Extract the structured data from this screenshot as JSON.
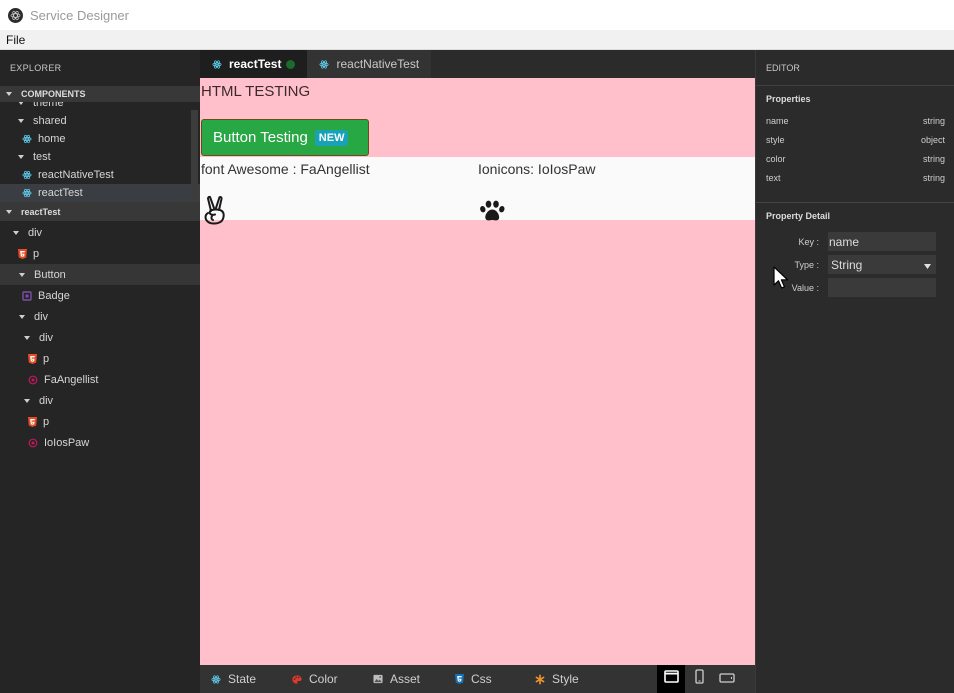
{
  "app": {
    "title": "Service Designer"
  },
  "menu": {
    "file": "File"
  },
  "explorer": {
    "header": "EXPLORER",
    "components_header": "COMPONENTS",
    "component_items": [
      {
        "label": "theme",
        "type": "folder"
      },
      {
        "label": "shared",
        "type": "folder"
      },
      {
        "label": "home",
        "type": "react"
      },
      {
        "label": "test",
        "type": "folder"
      },
      {
        "label": "reactNativeTest",
        "type": "react"
      },
      {
        "label": "reactTest",
        "type": "react"
      }
    ],
    "tree_header": "reactTest",
    "tree_items": [
      {
        "label": "div",
        "type": "folder"
      },
      {
        "label": "p",
        "type": "html5"
      },
      {
        "label": "Button",
        "type": "folder"
      },
      {
        "label": "Badge",
        "type": "component"
      },
      {
        "label": "div",
        "type": "folder"
      },
      {
        "label": "div",
        "type": "folder"
      },
      {
        "label": "p",
        "type": "html5"
      },
      {
        "label": "FaAngellist",
        "type": "icon"
      },
      {
        "label": "div",
        "type": "folder"
      },
      {
        "label": "p",
        "type": "html5"
      },
      {
        "label": "IoIosPaw",
        "type": "icon"
      }
    ]
  },
  "tabs": [
    {
      "label": "reactTest",
      "active": true,
      "modified": true
    },
    {
      "label": "reactNativeTest",
      "active": false,
      "modified": false
    }
  ],
  "canvas": {
    "heading": "HTML TESTING",
    "button_label": "Button Testing",
    "badge_label": "NEW",
    "fa_label": "font Awesome : FaAngellist",
    "io_label": "Ionicons: IoIosPaw",
    "background_color": "#ffc0cb"
  },
  "bottom_bar": {
    "items": [
      "State",
      "Color",
      "Asset",
      "Css",
      "Style"
    ],
    "view_modes": [
      "desktop-icon",
      "mobile-icon",
      "tablet-icon"
    ],
    "active_view": "desktop-icon"
  },
  "editor": {
    "header": "EDITOR",
    "properties_title": "Properties",
    "properties": [
      {
        "name": "name",
        "type": "string"
      },
      {
        "name": "style",
        "type": "object"
      },
      {
        "name": "color",
        "type": "string"
      },
      {
        "name": "text",
        "type": "string"
      }
    ],
    "detail_title": "Property Detail",
    "key_label": "Key :",
    "key_value": "name",
    "type_label": "Type :",
    "type_value": "String",
    "value_label": "Value :",
    "value_value": ""
  }
}
